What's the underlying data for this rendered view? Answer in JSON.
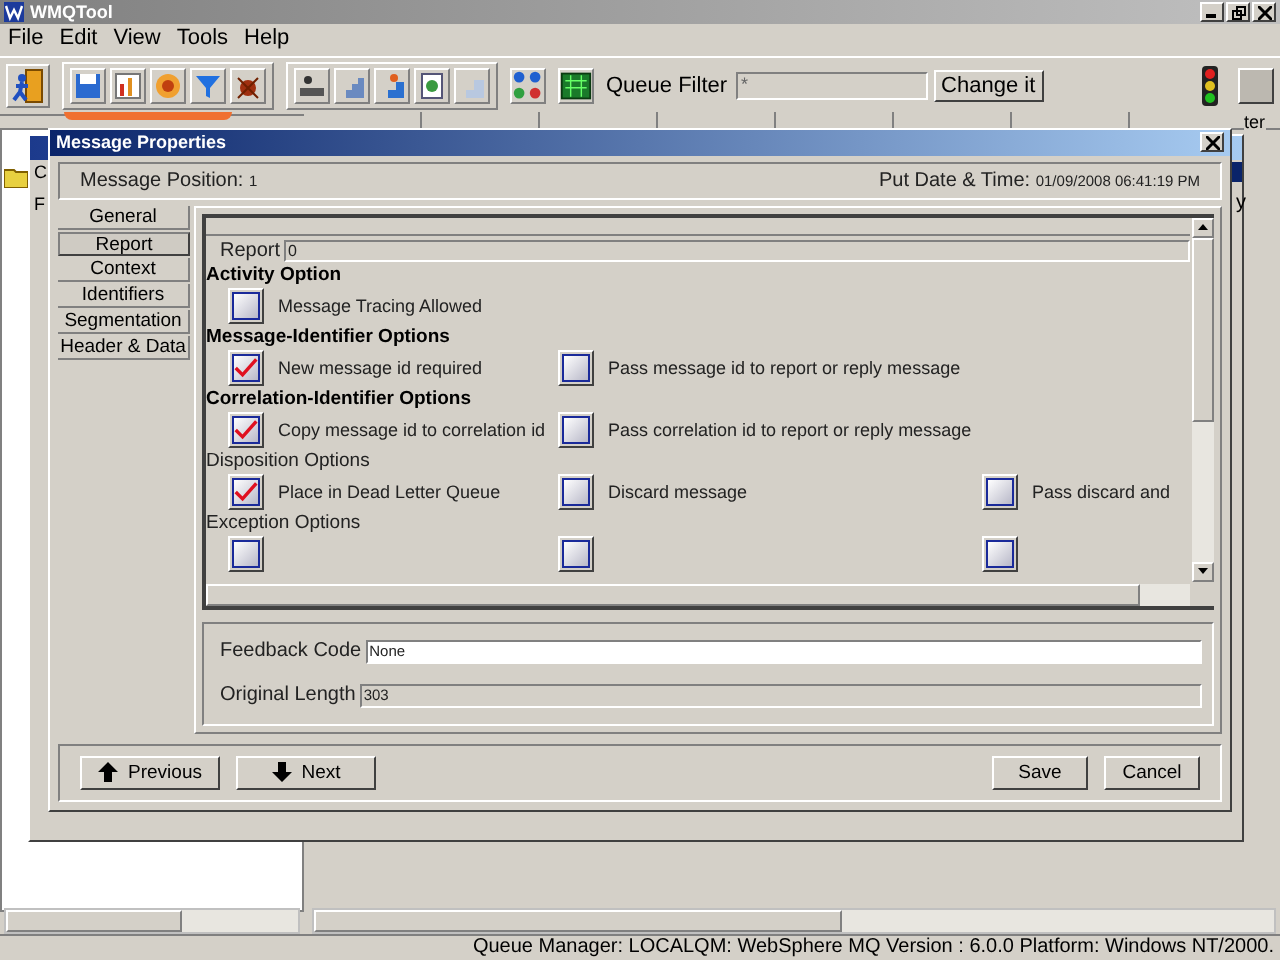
{
  "window": {
    "title": "WMQTool"
  },
  "menu": [
    "File",
    "Edit",
    "View",
    "Tools",
    "Help"
  ],
  "toolbar": {
    "queue_filter_label": "Queue Filter",
    "queue_filter_value": "*",
    "change_button": "Change it"
  },
  "background": {
    "column_fragment": "ter",
    "left_fragments": [
      "C",
      "F"
    ],
    "right_fragment": "y"
  },
  "dialog": {
    "title": "Message Properties",
    "position_label": "Message Position:",
    "position_value": "1",
    "put_label": "Put Date & Time:",
    "put_value": "01/09/2008 06:41:19 PM",
    "tabs": [
      {
        "label": "General",
        "selected": false
      },
      {
        "label": "Report",
        "selected": true
      },
      {
        "label": "Context",
        "selected": false
      },
      {
        "label": "Identifiers",
        "selected": false
      },
      {
        "label": "Segmentation",
        "selected": false
      },
      {
        "label": "Header & Data",
        "selected": false
      }
    ],
    "report_label": "Report",
    "report_value": "0",
    "sections": [
      {
        "title": "Activity Option",
        "bold": true,
        "options": [
          {
            "label": "Message Tracing Allowed",
            "checked": false
          }
        ]
      },
      {
        "title": "Message-Identifier Options",
        "bold": true,
        "options": [
          {
            "label": "New message id required",
            "checked": true
          },
          {
            "label": "Pass message id to report or reply message",
            "checked": false
          }
        ]
      },
      {
        "title": "Correlation-Identifier Options",
        "bold": true,
        "options": [
          {
            "label": "Copy message id to correlation id",
            "checked": true
          },
          {
            "label": "Pass correlation id to report or reply message",
            "checked": false
          }
        ]
      },
      {
        "title": "Disposition Options",
        "bold": false,
        "options": [
          {
            "label": "Place in Dead Letter Queue",
            "checked": true
          },
          {
            "label": "Discard message",
            "checked": false
          },
          {
            "label": "Pass discard and",
            "checked": false
          }
        ]
      },
      {
        "title": "Exception Options",
        "bold": false,
        "options": [
          {
            "checked": false
          },
          {
            "checked": false
          },
          {
            "checked": false
          }
        ]
      }
    ],
    "feedback_label": "Feedback Code",
    "feedback_value": "None",
    "length_label": "Original Length",
    "length_value": "303",
    "buttons": {
      "previous": "Previous",
      "next": "Next",
      "save": "Save",
      "cancel": "Cancel"
    }
  },
  "status_bar": "Queue Manager: LOCALQM: WebSphere MQ Version : 6.0.0 Platform: Windows NT/2000."
}
